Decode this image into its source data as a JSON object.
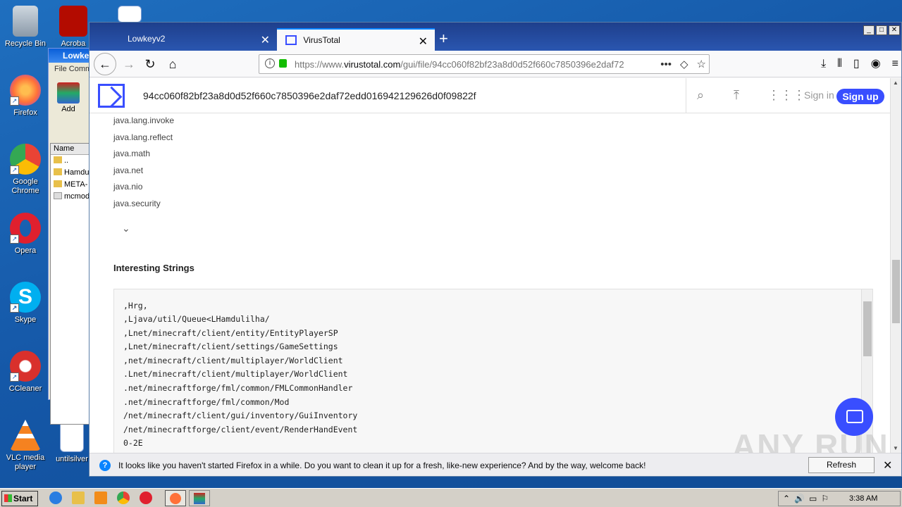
{
  "desktop": {
    "icons": [
      {
        "label": "Recycle Bin",
        "color": "#9aa7b4"
      },
      {
        "label": "Firefox",
        "color": "#ff7139"
      },
      {
        "label": "Google Chrome",
        "color": "#4285f4"
      },
      {
        "label": "Opera",
        "color": "#e0202e"
      },
      {
        "label": "Skype",
        "color": "#00aff0"
      },
      {
        "label": "CCleaner",
        "color": "#d9302c"
      },
      {
        "label": "VLC media player",
        "color": "#f58220"
      }
    ],
    "partial_icons": [
      "Acroba",
      "untilsilver"
    ]
  },
  "winrar": {
    "title": "Lowke",
    "menu": "File  Comm",
    "add_label": "Add",
    "list_header": "Name",
    "rows": [
      "..",
      "Hamdu",
      "META-",
      "mcmod"
    ]
  },
  "browser": {
    "tabs": [
      {
        "title": "Lowkeyv2"
      },
      {
        "title": "VirusTotal"
      }
    ],
    "url_prefix": "https://www.",
    "url_domain": "virustotal.com",
    "url_path": "/gui/file/94cc060f82bf23a8d0d52f660c7850396e2daf72"
  },
  "vt": {
    "hash": "94cc060f82bf23a8d0d52f660c7850396e2daf72edd016942129626d0f09822f",
    "sign_in": "Sign in",
    "sign_up": "Sign up",
    "accent": "#394eff"
  },
  "content": {
    "packages": [
      "java.lang.invoke",
      "java.lang.reflect",
      "java.math",
      "java.net",
      "java.nio",
      "java.security"
    ],
    "section_title": "Interesting Strings",
    "strings": [
      ",Hrg,",
      ",Ljava/util/Queue<LHamdulilha/",
      ",Lnet/minecraft/client/entity/EntityPlayerSP",
      ",Lnet/minecraft/client/settings/GameSettings",
      ",net/minecraft/client/multiplayer/WorldClient",
      ".Lnet/minecraft/client/multiplayer/WorldClient",
      ".net/minecraftforge/fml/common/FMLCommonHandler",
      ".net/minecraftforge/fml/common/Mod",
      "/net/minecraft/client/gui/inventory/GuiInventory",
      "/net/minecraftforge/client/event/RenderHandEvent",
      "0-2E"
    ],
    "watermark": "ANY RUN"
  },
  "notification": {
    "message": "It looks like you haven't started Firefox in a while. Do you want to clean it up for a fresh, like-new experience? And by the way, welcome back!",
    "button": "Refresh Firefox...",
    "icon": "?"
  },
  "taskbar": {
    "start": "Start",
    "clock": "3:38 AM"
  }
}
